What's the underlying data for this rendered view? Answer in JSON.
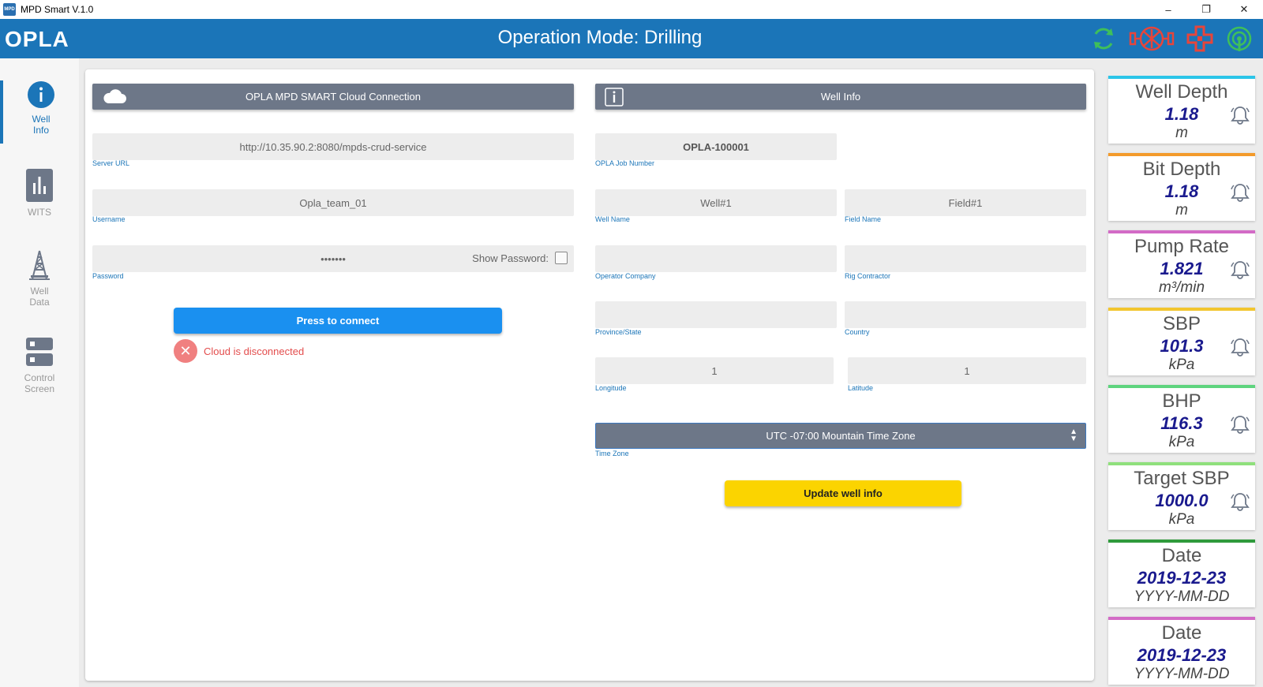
{
  "window": {
    "title": "MPD Smart V.1.0",
    "app_icon_text": "MPD",
    "controls": {
      "minimize": "–",
      "restore": "❐",
      "close": "✕"
    }
  },
  "header": {
    "logo": "OPLA",
    "title": "Operation Mode: Drilling",
    "icons": [
      "refresh-icon",
      "pump-icon",
      "medical-cross-icon",
      "signal-icon"
    ],
    "icon_colors": {
      "refresh": "#3fbf5a",
      "alert": "#e8453a",
      "signal": "#3fbf5a"
    }
  },
  "nav": {
    "items": [
      {
        "label_line1": "Well",
        "label_line2": "Info",
        "icon": "info-icon",
        "active": true
      },
      {
        "label_line1": "WITS",
        "label_line2": "",
        "icon": "bar-chart-icon",
        "active": false
      },
      {
        "label_line1": "Well",
        "label_line2": "Data",
        "icon": "drilling-rig-icon",
        "active": false
      },
      {
        "label_line1": "Control",
        "label_line2": "Screen",
        "icon": "server-icon",
        "active": false
      }
    ]
  },
  "cloud": {
    "header": "OPLA MPD SMART Cloud Connection",
    "server_url": {
      "value": "http://10.35.90.2:8080/mpds-crud-service",
      "label": "Server URL"
    },
    "username": {
      "value": "Opla_team_01",
      "label": "Username"
    },
    "password": {
      "value": "•••••••",
      "label": "Password",
      "show_label": "Show Password:"
    },
    "connect_button": "Press to connect",
    "status": "Cloud is disconnected"
  },
  "well_info": {
    "header": "Well Info",
    "job_number": {
      "value": "OPLA-100001",
      "label": "OPLA Job Number"
    },
    "well_name": {
      "value": "Well#1",
      "label": "Well Name"
    },
    "field_name": {
      "value": "Field#1",
      "label": "Field Name"
    },
    "operator_company": {
      "value": "",
      "label": "Operator Company"
    },
    "rig_contractor": {
      "value": "",
      "label": "Rig Contractor"
    },
    "province": {
      "value": "",
      "label": "Province/State"
    },
    "country": {
      "value": "",
      "label": "Country"
    },
    "longitude": {
      "value": "1",
      "label": "Longitude"
    },
    "latitude": {
      "value": "1",
      "label": "Latitude"
    },
    "timezone": {
      "value": "UTC -07:00 Mountain Time Zone",
      "label": "Time Zone"
    },
    "update_button": "Update well info"
  },
  "gauges": [
    {
      "title": "Well Depth",
      "value": "1.18",
      "unit": "m",
      "color": "#2bc5e8"
    },
    {
      "title": "Bit Depth",
      "value": "1.18",
      "unit": "m",
      "color": "#f39a2b"
    },
    {
      "title": "Pump Rate",
      "value": "1.821",
      "unit": "m³/min",
      "color": "#d36bc6"
    },
    {
      "title": "SBP",
      "value": "101.3",
      "unit": "kPa",
      "color": "#f2c62e"
    },
    {
      "title": "BHP",
      "value": "116.3",
      "unit": "kPa",
      "color": "#5ed47e"
    },
    {
      "title": "Target SBP",
      "value": "1000.0",
      "unit": "kPa",
      "color": "#8fe07c"
    },
    {
      "title": "Date",
      "value": "2019-12-23",
      "unit": "YYYY-MM-DD",
      "color": "#2f9a3c"
    },
    {
      "title": "Date",
      "value": "2019-12-23",
      "unit": "YYYY-MM-DD",
      "color": "#d36bc6"
    }
  ]
}
